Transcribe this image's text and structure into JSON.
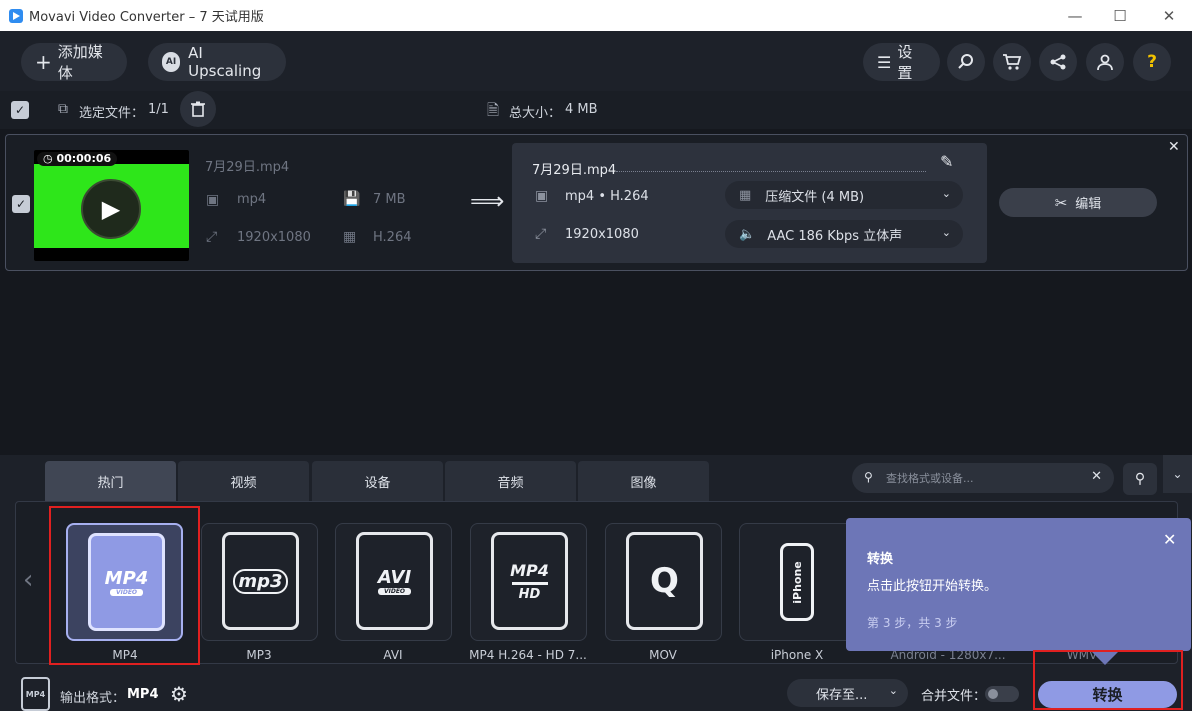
{
  "window": {
    "title": "Movavi Video Converter – 7 天试用版"
  },
  "toolbar": {
    "add_media": "添加媒体",
    "ai_upscaling": "AI Upscaling",
    "settings": "设置"
  },
  "selection": {
    "label": "选定文件：",
    "count": "1/1",
    "total_label": "总大小：",
    "total_value": "4 MB"
  },
  "file": {
    "duration": "00:00:06",
    "name": "7月29日.mp4",
    "format": "mp4",
    "size": "7 MB",
    "resolution": "1920x1080",
    "codec": "H.264"
  },
  "output": {
    "name": "7月29日.mp4",
    "format": "mp4 • H.264",
    "resolution": "1920x1080",
    "compress": "压缩文件 (4 MB)",
    "audio": "AAC 186 Kbps 立体声",
    "edit_label": "编辑"
  },
  "tabs": [
    "热门",
    "视频",
    "设备",
    "音频",
    "图像"
  ],
  "search": {
    "placeholder": "查找格式或设备..."
  },
  "formats": [
    {
      "label": "MP4",
      "icon_text": "MP4",
      "sub": "VIDEO"
    },
    {
      "label": "MP3",
      "icon_text": "mp3",
      "sub": ""
    },
    {
      "label": "AVI",
      "icon_text": "AVI",
      "sub": "VIDEO"
    },
    {
      "label": "MP4 H.264 - HD 7...",
      "icon_text": "MP4",
      "sub": "HD"
    },
    {
      "label": "MOV",
      "icon_text": "Q",
      "sub": ""
    },
    {
      "label": "iPhone X",
      "icon_text": "iPhone",
      "sub": ""
    },
    {
      "label": "Android - 1280x7...",
      "icon_text": "",
      "sub": ""
    },
    {
      "label": "WMV",
      "icon_text": "",
      "sub": ""
    }
  ],
  "popup": {
    "title": "转换",
    "text": "点击此按钮开始转换。",
    "step": "第 3 步，共 3 步"
  },
  "footer": {
    "output_label": "输出格式：",
    "output_format": "MP4",
    "mini_icon_text": "MP4",
    "save_to": "保存至...",
    "merge_label": "合并文件：",
    "convert": "转换"
  },
  "colors": {
    "accent": "#8f9ae4",
    "popup": "#6d76b7",
    "highlight": "#e02020",
    "preview": "#2ee61a"
  }
}
